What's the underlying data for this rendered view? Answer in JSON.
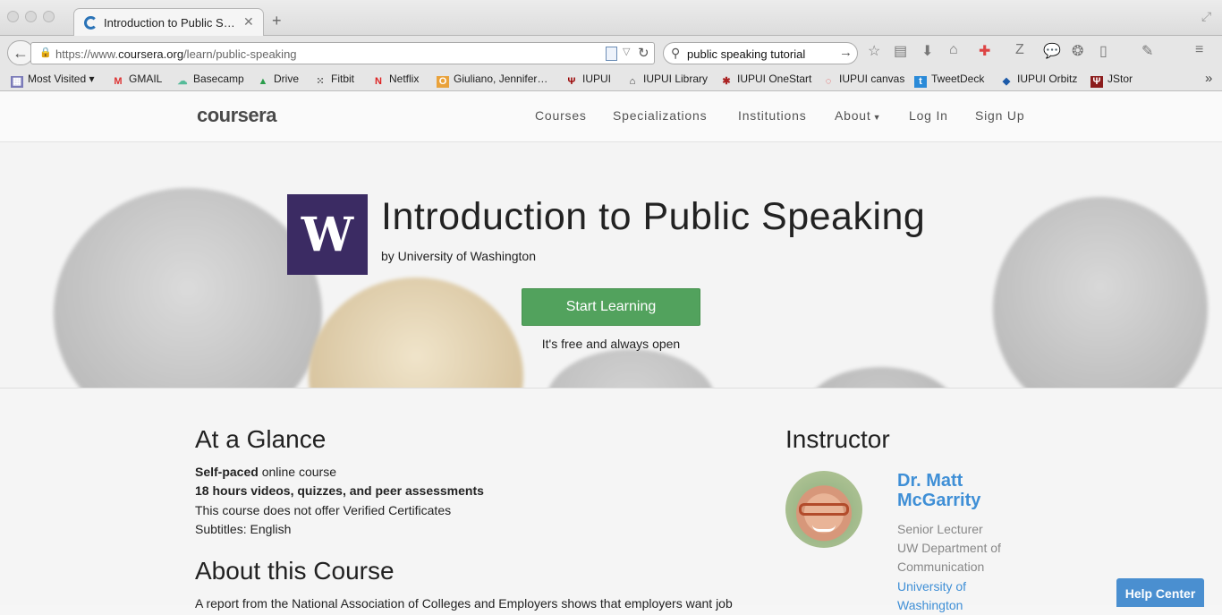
{
  "browser": {
    "tab_title": "Introduction to Public Spe…",
    "url_prefix": "https://www.",
    "url_domain": "coursera.org",
    "url_path": "/learn/public-speaking",
    "search_query": "public speaking tutorial",
    "bookmarks": [
      {
        "label": "Most Visited ▾",
        "icon": "folder-icon"
      },
      {
        "label": "GMAIL",
        "icon": "gmail-icon"
      },
      {
        "label": "Basecamp",
        "icon": "basecamp-icon"
      },
      {
        "label": "Drive",
        "icon": "drive-icon"
      },
      {
        "label": "Fitbit",
        "icon": "fitbit-icon"
      },
      {
        "label": "Netflix",
        "icon": "netflix-icon"
      },
      {
        "label": "Giuliano, Jennifer…",
        "icon": "outlook-icon"
      },
      {
        "label": "IUPUI",
        "icon": "iu-icon"
      },
      {
        "label": "IUPUI Library",
        "icon": "library-icon"
      },
      {
        "label": "IUPUI OneStart",
        "icon": "onestart-icon"
      },
      {
        "label": "IUPUI canvas",
        "icon": "canvas-icon"
      },
      {
        "label": "TweetDeck",
        "icon": "tweetdeck-icon"
      },
      {
        "label": "IUPUI Orbitz",
        "icon": "orbitz-icon"
      },
      {
        "label": "JStor",
        "icon": "jstor-icon"
      }
    ]
  },
  "site": {
    "logo": "coursera",
    "nav": [
      "Courses",
      "Specializations",
      "Institutions",
      "About",
      "Log In",
      "Sign Up"
    ]
  },
  "hero": {
    "logo_letter": "W",
    "title": "Introduction to Public Speaking",
    "byline": "by University of Washington",
    "cta": "Start Learning",
    "cta_note": "It's free and always open"
  },
  "glance": {
    "heading": "At a Glance",
    "line1_bold": "Self-paced",
    "line1_rest": " online course",
    "line2": "18 hours videos, quizzes, and peer assessments",
    "line3": "This course does not offer Verified Certificates",
    "line4": "Subtitles: English"
  },
  "about": {
    "heading": "About this Course",
    "text": "A report from the National Association of Colleges and Employers shows that employers want job"
  },
  "instructor": {
    "heading": "Instructor",
    "name": "Dr. Matt McGarrity",
    "role": "Senior Lecturer",
    "dept1": "UW Department of",
    "dept2": "Communication",
    "university": "University of Washington"
  },
  "help": "Help Center",
  "colors": {
    "accent_green": "#52a25d",
    "uw_purple": "#3b2b63",
    "link_blue": "#3f8fd6",
    "help_blue": "#4a8fd0"
  }
}
